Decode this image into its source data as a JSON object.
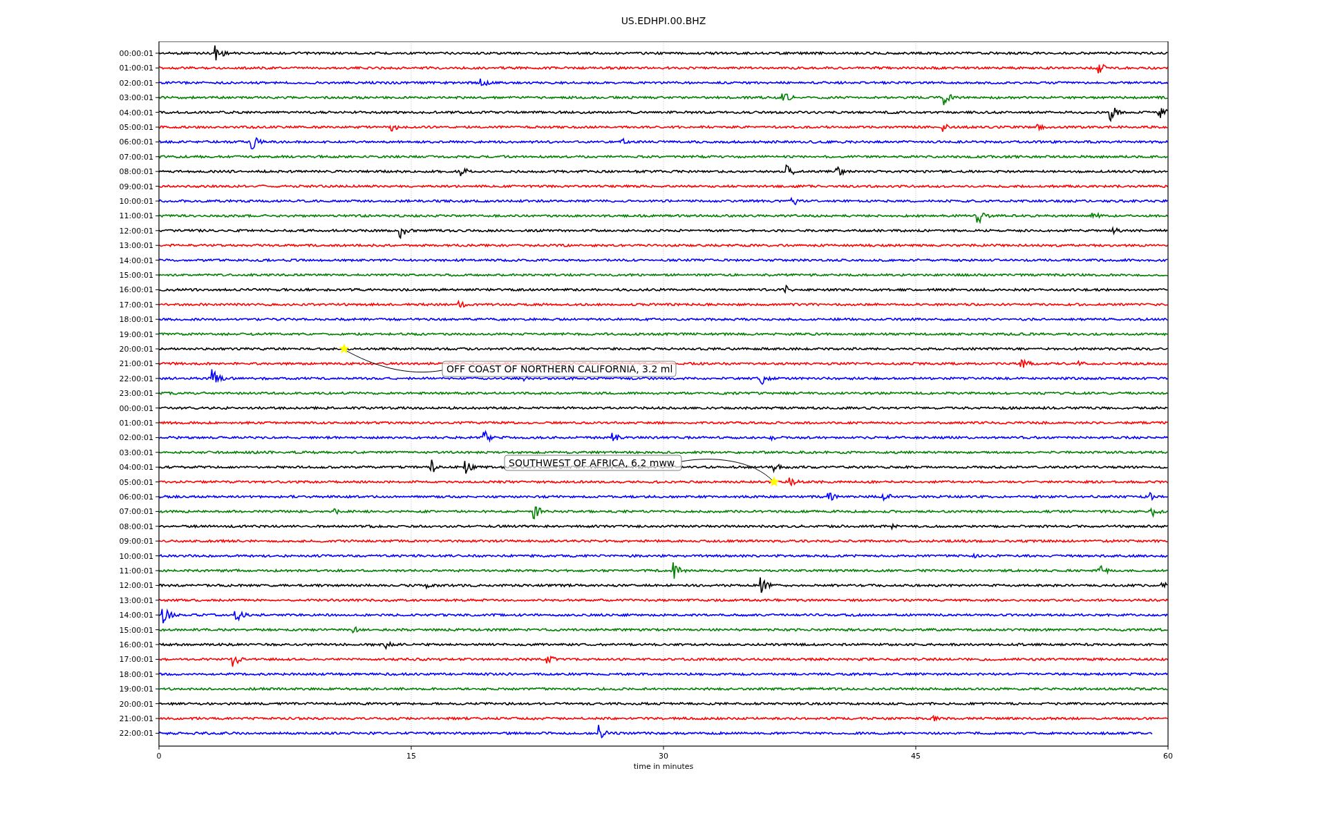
{
  "title": "US.EDHPI.00.BHZ",
  "rows": [
    {
      "label": "00:00:01",
      "color": "#000000"
    },
    {
      "label": "01:00:01",
      "color": "#ff0000"
    },
    {
      "label": "02:00:01",
      "color": "#0000ff"
    },
    {
      "label": "03:00:01",
      "color": "#008000"
    },
    {
      "label": "04:00:01",
      "color": "#000000"
    },
    {
      "label": "05:00:01",
      "color": "#ff0000"
    },
    {
      "label": "06:00:01",
      "color": "#0000ff"
    },
    {
      "label": "07:00:01",
      "color": "#008000"
    },
    {
      "label": "08:00:01",
      "color": "#000000"
    },
    {
      "label": "09:00:01",
      "color": "#ff0000"
    },
    {
      "label": "10:00:01",
      "color": "#0000ff"
    },
    {
      "label": "11:00:01",
      "color": "#008000"
    },
    {
      "label": "12:00:01",
      "color": "#000000"
    },
    {
      "label": "13:00:01",
      "color": "#ff0000"
    },
    {
      "label": "14:00:01",
      "color": "#0000ff"
    },
    {
      "label": "15:00:01",
      "color": "#008000"
    },
    {
      "label": "16:00:01",
      "color": "#000000"
    },
    {
      "label": "17:00:01",
      "color": "#ff0000"
    },
    {
      "label": "18:00:01",
      "color": "#0000ff"
    },
    {
      "label": "19:00:01",
      "color": "#008000"
    },
    {
      "label": "20:00:01",
      "color": "#000000"
    },
    {
      "label": "21:00:01",
      "color": "#ff0000"
    },
    {
      "label": "22:00:01",
      "color": "#0000ff"
    },
    {
      "label": "23:00:01",
      "color": "#008000"
    },
    {
      "label": "00:00:01",
      "color": "#000000"
    },
    {
      "label": "01:00:01",
      "color": "#ff0000"
    },
    {
      "label": "02:00:01",
      "color": "#0000ff"
    },
    {
      "label": "03:00:01",
      "color": "#008000"
    },
    {
      "label": "04:00:01",
      "color": "#000000"
    },
    {
      "label": "05:00:01",
      "color": "#ff0000"
    },
    {
      "label": "06:00:01",
      "color": "#0000ff"
    },
    {
      "label": "07:00:01",
      "color": "#008000"
    },
    {
      "label": "08:00:01",
      "color": "#000000"
    },
    {
      "label": "09:00:01",
      "color": "#ff0000"
    },
    {
      "label": "10:00:01",
      "color": "#0000ff"
    },
    {
      "label": "11:00:01",
      "color": "#008000"
    },
    {
      "label": "12:00:01",
      "color": "#000000"
    },
    {
      "label": "13:00:01",
      "color": "#ff0000"
    },
    {
      "label": "14:00:01",
      "color": "#0000ff"
    },
    {
      "label": "15:00:01",
      "color": "#008000"
    },
    {
      "label": "16:00:01",
      "color": "#000000"
    },
    {
      "label": "17:00:01",
      "color": "#ff0000"
    },
    {
      "label": "18:00:01",
      "color": "#0000ff"
    },
    {
      "label": "19:00:01",
      "color": "#008000"
    },
    {
      "label": "20:00:01",
      "color": "#000000"
    },
    {
      "label": "21:00:01",
      "color": "#ff0000"
    },
    {
      "label": "22:00:01",
      "color": "#0000ff"
    }
  ],
  "xticks": [
    "0",
    "15",
    "30",
    "45",
    "60"
  ],
  "xlabel": "time in minutes",
  "events": [
    {
      "label": "OFF COAST OF NORTHERN CALIFORNIA, 3.2 ml"
    },
    {
      "label": "SOUTHWEST OF AFRICA, 6.2 mww"
    }
  ]
}
